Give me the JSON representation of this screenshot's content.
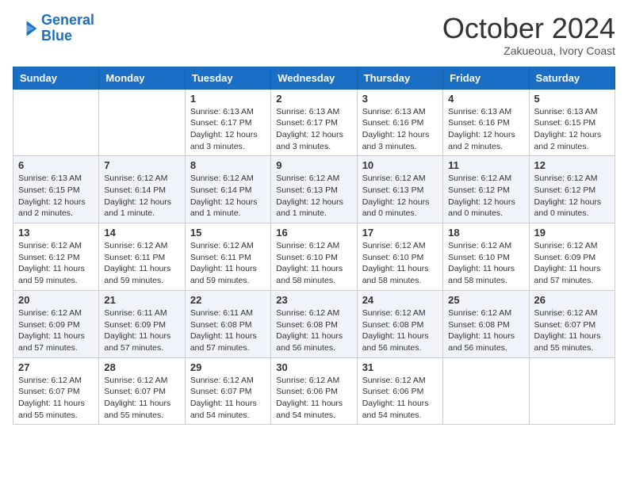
{
  "logo": {
    "line1": "General",
    "line2": "Blue"
  },
  "title": "October 2024",
  "subtitle": "Zakueoua, Ivory Coast",
  "days_of_week": [
    "Sunday",
    "Monday",
    "Tuesday",
    "Wednesday",
    "Thursday",
    "Friday",
    "Saturday"
  ],
  "weeks": [
    [
      {
        "day": "",
        "info": ""
      },
      {
        "day": "",
        "info": ""
      },
      {
        "day": "1",
        "info": "Sunrise: 6:13 AM\nSunset: 6:17 PM\nDaylight: 12 hours and 3 minutes."
      },
      {
        "day": "2",
        "info": "Sunrise: 6:13 AM\nSunset: 6:17 PM\nDaylight: 12 hours and 3 minutes."
      },
      {
        "day": "3",
        "info": "Sunrise: 6:13 AM\nSunset: 6:16 PM\nDaylight: 12 hours and 3 minutes."
      },
      {
        "day": "4",
        "info": "Sunrise: 6:13 AM\nSunset: 6:16 PM\nDaylight: 12 hours and 2 minutes."
      },
      {
        "day": "5",
        "info": "Sunrise: 6:13 AM\nSunset: 6:15 PM\nDaylight: 12 hours and 2 minutes."
      }
    ],
    [
      {
        "day": "6",
        "info": "Sunrise: 6:13 AM\nSunset: 6:15 PM\nDaylight: 12 hours and 2 minutes."
      },
      {
        "day": "7",
        "info": "Sunrise: 6:12 AM\nSunset: 6:14 PM\nDaylight: 12 hours and 1 minute."
      },
      {
        "day": "8",
        "info": "Sunrise: 6:12 AM\nSunset: 6:14 PM\nDaylight: 12 hours and 1 minute."
      },
      {
        "day": "9",
        "info": "Sunrise: 6:12 AM\nSunset: 6:13 PM\nDaylight: 12 hours and 1 minute."
      },
      {
        "day": "10",
        "info": "Sunrise: 6:12 AM\nSunset: 6:13 PM\nDaylight: 12 hours and 0 minutes."
      },
      {
        "day": "11",
        "info": "Sunrise: 6:12 AM\nSunset: 6:12 PM\nDaylight: 12 hours and 0 minutes."
      },
      {
        "day": "12",
        "info": "Sunrise: 6:12 AM\nSunset: 6:12 PM\nDaylight: 12 hours and 0 minutes."
      }
    ],
    [
      {
        "day": "13",
        "info": "Sunrise: 6:12 AM\nSunset: 6:12 PM\nDaylight: 11 hours and 59 minutes."
      },
      {
        "day": "14",
        "info": "Sunrise: 6:12 AM\nSunset: 6:11 PM\nDaylight: 11 hours and 59 minutes."
      },
      {
        "day": "15",
        "info": "Sunrise: 6:12 AM\nSunset: 6:11 PM\nDaylight: 11 hours and 59 minutes."
      },
      {
        "day": "16",
        "info": "Sunrise: 6:12 AM\nSunset: 6:10 PM\nDaylight: 11 hours and 58 minutes."
      },
      {
        "day": "17",
        "info": "Sunrise: 6:12 AM\nSunset: 6:10 PM\nDaylight: 11 hours and 58 minutes."
      },
      {
        "day": "18",
        "info": "Sunrise: 6:12 AM\nSunset: 6:10 PM\nDaylight: 11 hours and 58 minutes."
      },
      {
        "day": "19",
        "info": "Sunrise: 6:12 AM\nSunset: 6:09 PM\nDaylight: 11 hours and 57 minutes."
      }
    ],
    [
      {
        "day": "20",
        "info": "Sunrise: 6:12 AM\nSunset: 6:09 PM\nDaylight: 11 hours and 57 minutes."
      },
      {
        "day": "21",
        "info": "Sunrise: 6:11 AM\nSunset: 6:09 PM\nDaylight: 11 hours and 57 minutes."
      },
      {
        "day": "22",
        "info": "Sunrise: 6:11 AM\nSunset: 6:08 PM\nDaylight: 11 hours and 57 minutes."
      },
      {
        "day": "23",
        "info": "Sunrise: 6:12 AM\nSunset: 6:08 PM\nDaylight: 11 hours and 56 minutes."
      },
      {
        "day": "24",
        "info": "Sunrise: 6:12 AM\nSunset: 6:08 PM\nDaylight: 11 hours and 56 minutes."
      },
      {
        "day": "25",
        "info": "Sunrise: 6:12 AM\nSunset: 6:08 PM\nDaylight: 11 hours and 56 minutes."
      },
      {
        "day": "26",
        "info": "Sunrise: 6:12 AM\nSunset: 6:07 PM\nDaylight: 11 hours and 55 minutes."
      }
    ],
    [
      {
        "day": "27",
        "info": "Sunrise: 6:12 AM\nSunset: 6:07 PM\nDaylight: 11 hours and 55 minutes."
      },
      {
        "day": "28",
        "info": "Sunrise: 6:12 AM\nSunset: 6:07 PM\nDaylight: 11 hours and 55 minutes."
      },
      {
        "day": "29",
        "info": "Sunrise: 6:12 AM\nSunset: 6:07 PM\nDaylight: 11 hours and 54 minutes."
      },
      {
        "day": "30",
        "info": "Sunrise: 6:12 AM\nSunset: 6:06 PM\nDaylight: 11 hours and 54 minutes."
      },
      {
        "day": "31",
        "info": "Sunrise: 6:12 AM\nSunset: 6:06 PM\nDaylight: 11 hours and 54 minutes."
      },
      {
        "day": "",
        "info": ""
      },
      {
        "day": "",
        "info": ""
      }
    ]
  ]
}
